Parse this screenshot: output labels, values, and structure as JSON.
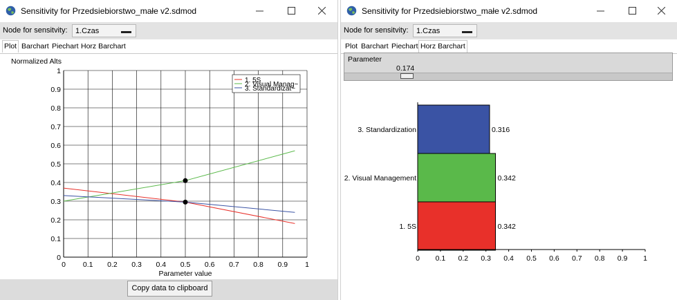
{
  "left_window": {
    "title": "Sensitivity for Przedsiebiorstwo_małe v2.sdmod",
    "node_label": "Node for sensitvity:",
    "node_value": "1.Czas",
    "tabs": [
      "Plot",
      "Barchart",
      "Piechart",
      "Horz Barchart"
    ],
    "active_tab": "Plot",
    "copy_button": "Copy data to clipboard"
  },
  "right_window": {
    "title": "Sensitivity for Przedsiebiorstwo_małe v2.sdmod",
    "node_label": "Node for sensitvity:",
    "node_value": "1.Czas",
    "tabs": [
      "Plot",
      "Barchart",
      "Piechart",
      "Horz Barchart"
    ],
    "active_tab": "Horz Barchart",
    "parameter_label": "Parameter",
    "parameter_value": "0.174",
    "parameter_fraction": 0.174
  },
  "colors": {
    "red": "#e8302a",
    "green": "#5ab94a",
    "blue": "#3a53a4"
  },
  "chart_data": [
    {
      "type": "line",
      "ylabel": "Normalized Alts",
      "xlabel": "Parameter value",
      "xlim": [
        0,
        1
      ],
      "ylim": [
        0,
        1
      ],
      "xticks": [
        "0",
        "0.1",
        "0.2",
        "0.3",
        "0.4",
        "0.5",
        "0.6",
        "0.7",
        "0.8",
        "0.9",
        "1"
      ],
      "yticks": [
        "0",
        "0.1",
        "0.2",
        "0.3",
        "0.4",
        "0.5",
        "0.6",
        "0.7",
        "0.8",
        "0.9",
        "1"
      ],
      "grid": true,
      "legend_position": "top-right",
      "series": [
        {
          "name": "1. 5S",
          "color": "#e8302a",
          "x": [
            0,
            0.5,
            0.95
          ],
          "y": [
            0.37,
            0.295,
            0.18
          ]
        },
        {
          "name": "2. Visual Manag~",
          "color": "#5ab94a",
          "x": [
            0,
            0.5,
            0.95
          ],
          "y": [
            0.3,
            0.41,
            0.57
          ]
        },
        {
          "name": "3. Standardizat~",
          "color": "#3a53a4",
          "x": [
            0,
            0.5,
            0.95
          ],
          "y": [
            0.33,
            0.295,
            0.24
          ]
        }
      ],
      "markers": [
        {
          "x": 0.5,
          "y": 0.41
        },
        {
          "x": 0.5,
          "y": 0.295
        }
      ]
    },
    {
      "type": "bar",
      "orientation": "horizontal",
      "categories": [
        "3. Standardization",
        "2. Visual Management",
        "1. 5S"
      ],
      "values": [
        0.316,
        0.342,
        0.342
      ],
      "value_labels": [
        "0.316",
        "0.342",
        "0.342"
      ],
      "colors": [
        "#3a53a4",
        "#5ab94a",
        "#e8302a"
      ],
      "xlim": [
        0,
        1
      ],
      "xticks": [
        "0",
        "0.1",
        "0.2",
        "0.3",
        "0.4",
        "0.5",
        "0.6",
        "0.7",
        "0.8",
        "0.9",
        "1"
      ]
    }
  ]
}
